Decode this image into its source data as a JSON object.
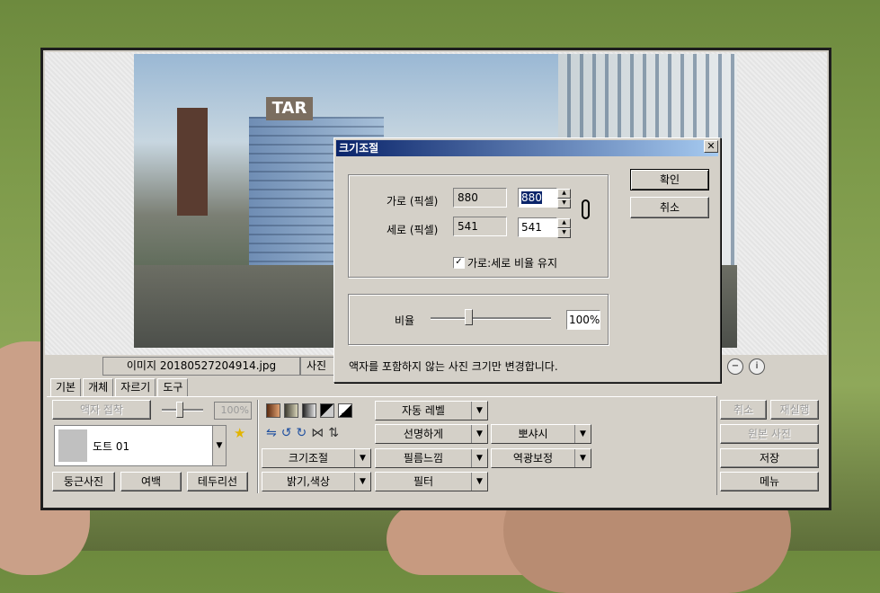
{
  "status": {
    "filename": "이미지 20180527204914.jpg",
    "size_label": "사진"
  },
  "tabs": [
    {
      "label": "기본"
    },
    {
      "label": "개체"
    },
    {
      "label": "자르기"
    },
    {
      "label": "도구"
    }
  ],
  "left_panel": {
    "frame_attach": "액자 접착",
    "opacity": "100%",
    "frame_name": "도트 01",
    "round_photo": "둥근사진",
    "margin": "여백",
    "border_line": "테두리선"
  },
  "middle_panel": {
    "resize": "크기조절",
    "brightness_color": "밝기,색상",
    "auto_level": "자동 레벨",
    "sharpen": "선명하게",
    "film_feel": "필름느낌",
    "filter": "필터",
    "soften": "뽀샤시",
    "backlight_correction": "역광보정"
  },
  "right_panel": {
    "undo": "취소",
    "redo": "재실행",
    "original": "원본 사진",
    "save": "저장",
    "menu": "메뉴"
  },
  "dialog": {
    "title": "크기조절",
    "width_label": "가로 (픽셀)",
    "height_label": "세로 (픽셀)",
    "width_original": "880",
    "height_original": "541",
    "width_value": "880",
    "height_value": "541",
    "keep_ratio_label": "가로:세로 비율 유지",
    "keep_ratio_checked": true,
    "ratio_label": "비율",
    "ratio_value": "100%",
    "ratio_level": 0.3,
    "ok": "확인",
    "cancel": "취소",
    "footnote": "액자를 포함하지 않는 사진 크기만 변경합니다."
  },
  "photo": {
    "sign_text": "TAR"
  }
}
